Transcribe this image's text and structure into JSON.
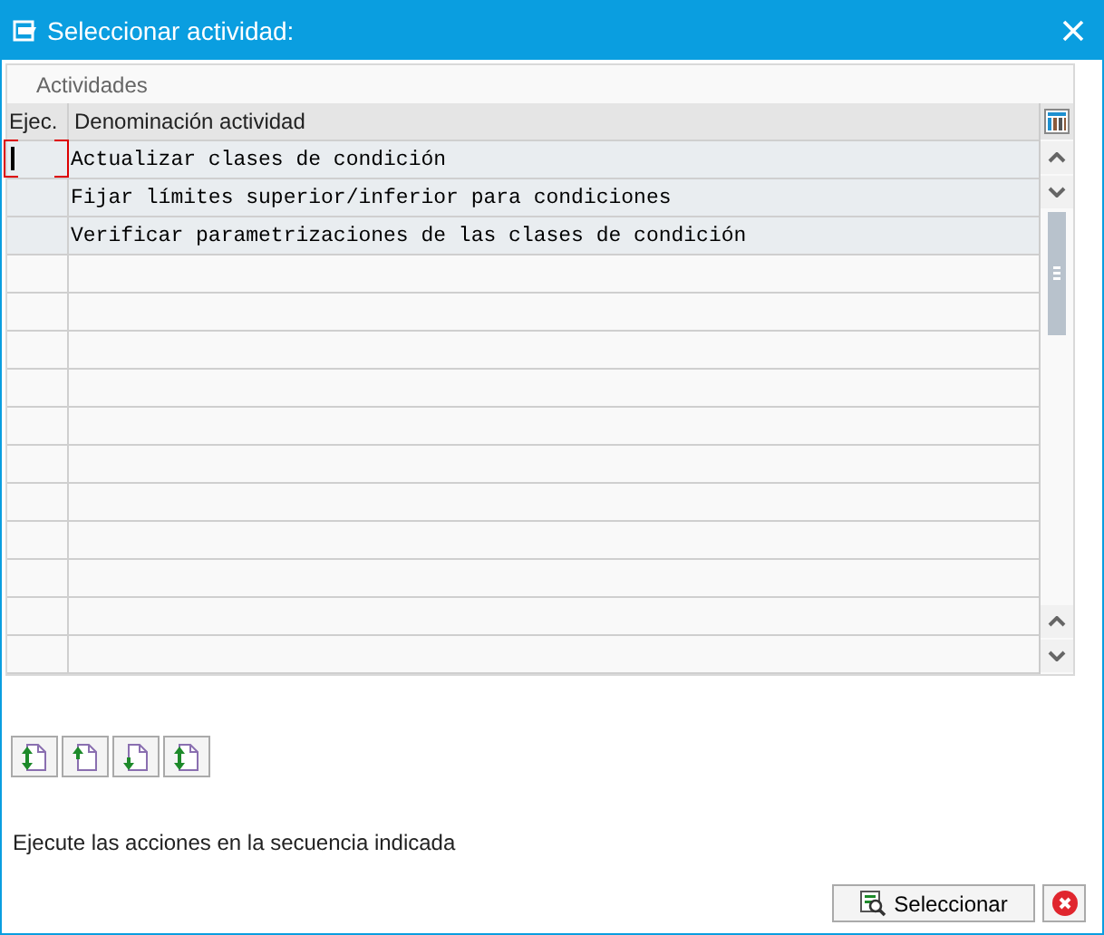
{
  "window": {
    "title": "Seleccionar actividad:"
  },
  "table": {
    "title": "Actividades",
    "columns": [
      "Ejec.",
      "Denominación actividad"
    ],
    "rows": [
      {
        "ejec": "",
        "name": "Actualizar clases de condición",
        "focused": true
      },
      {
        "ejec": "",
        "name": "Fijar límites superior/inferior para condiciones",
        "focused": false
      },
      {
        "ejec": "",
        "name": "Verificar parametrizaciones de las clases de condición",
        "focused": false
      }
    ]
  },
  "message": "Ejecute las acciones en la secuencia indicada",
  "buttons": [
    {
      "kind": "select",
      "label": "Seleccionar"
    },
    {
      "kind": "cancel"
    }
  ]
}
